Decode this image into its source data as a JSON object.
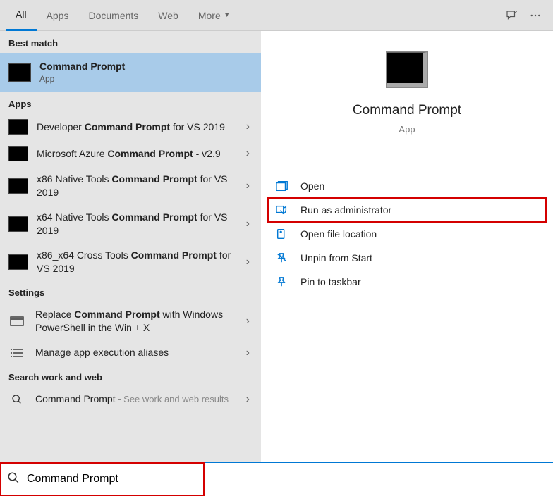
{
  "tabs": {
    "all": "All",
    "apps": "Apps",
    "documents": "Documents",
    "web": "Web",
    "more": "More"
  },
  "sections": {
    "best": "Best match",
    "apps": "Apps",
    "settings": "Settings",
    "web": "Search work and web"
  },
  "best": {
    "title": "Command Prompt",
    "sub": "App"
  },
  "apps_list": [
    {
      "pre": "Developer ",
      "bold": "Command Prompt",
      "post": " for VS 2019"
    },
    {
      "pre": "Microsoft Azure ",
      "bold": "Command Prompt",
      "post": " - v2.9"
    },
    {
      "pre": "x86 Native Tools ",
      "bold": "Command Prompt",
      "post": " for VS 2019"
    },
    {
      "pre": "x64 Native Tools ",
      "bold": "Command Prompt",
      "post": " for VS 2019"
    },
    {
      "pre": "x86_x64 Cross Tools ",
      "bold": "Command Prompt",
      "post": " for VS 2019"
    }
  ],
  "settings_list": [
    {
      "pre": "Replace ",
      "bold": "Command Prompt",
      "post": " with Windows PowerShell in the Win + X"
    },
    {
      "pre": "Manage app execution aliases",
      "bold": "",
      "post": ""
    }
  ],
  "web_list": {
    "label": "Command Prompt",
    "hint": " - See work and web results"
  },
  "preview": {
    "title": "Command Prompt",
    "sub": "App"
  },
  "actions": {
    "open": "Open",
    "admin": "Run as administrator",
    "loc": "Open file location",
    "unpin": "Unpin from Start",
    "pin": "Pin to taskbar"
  },
  "search": {
    "value": "Command Prompt"
  }
}
